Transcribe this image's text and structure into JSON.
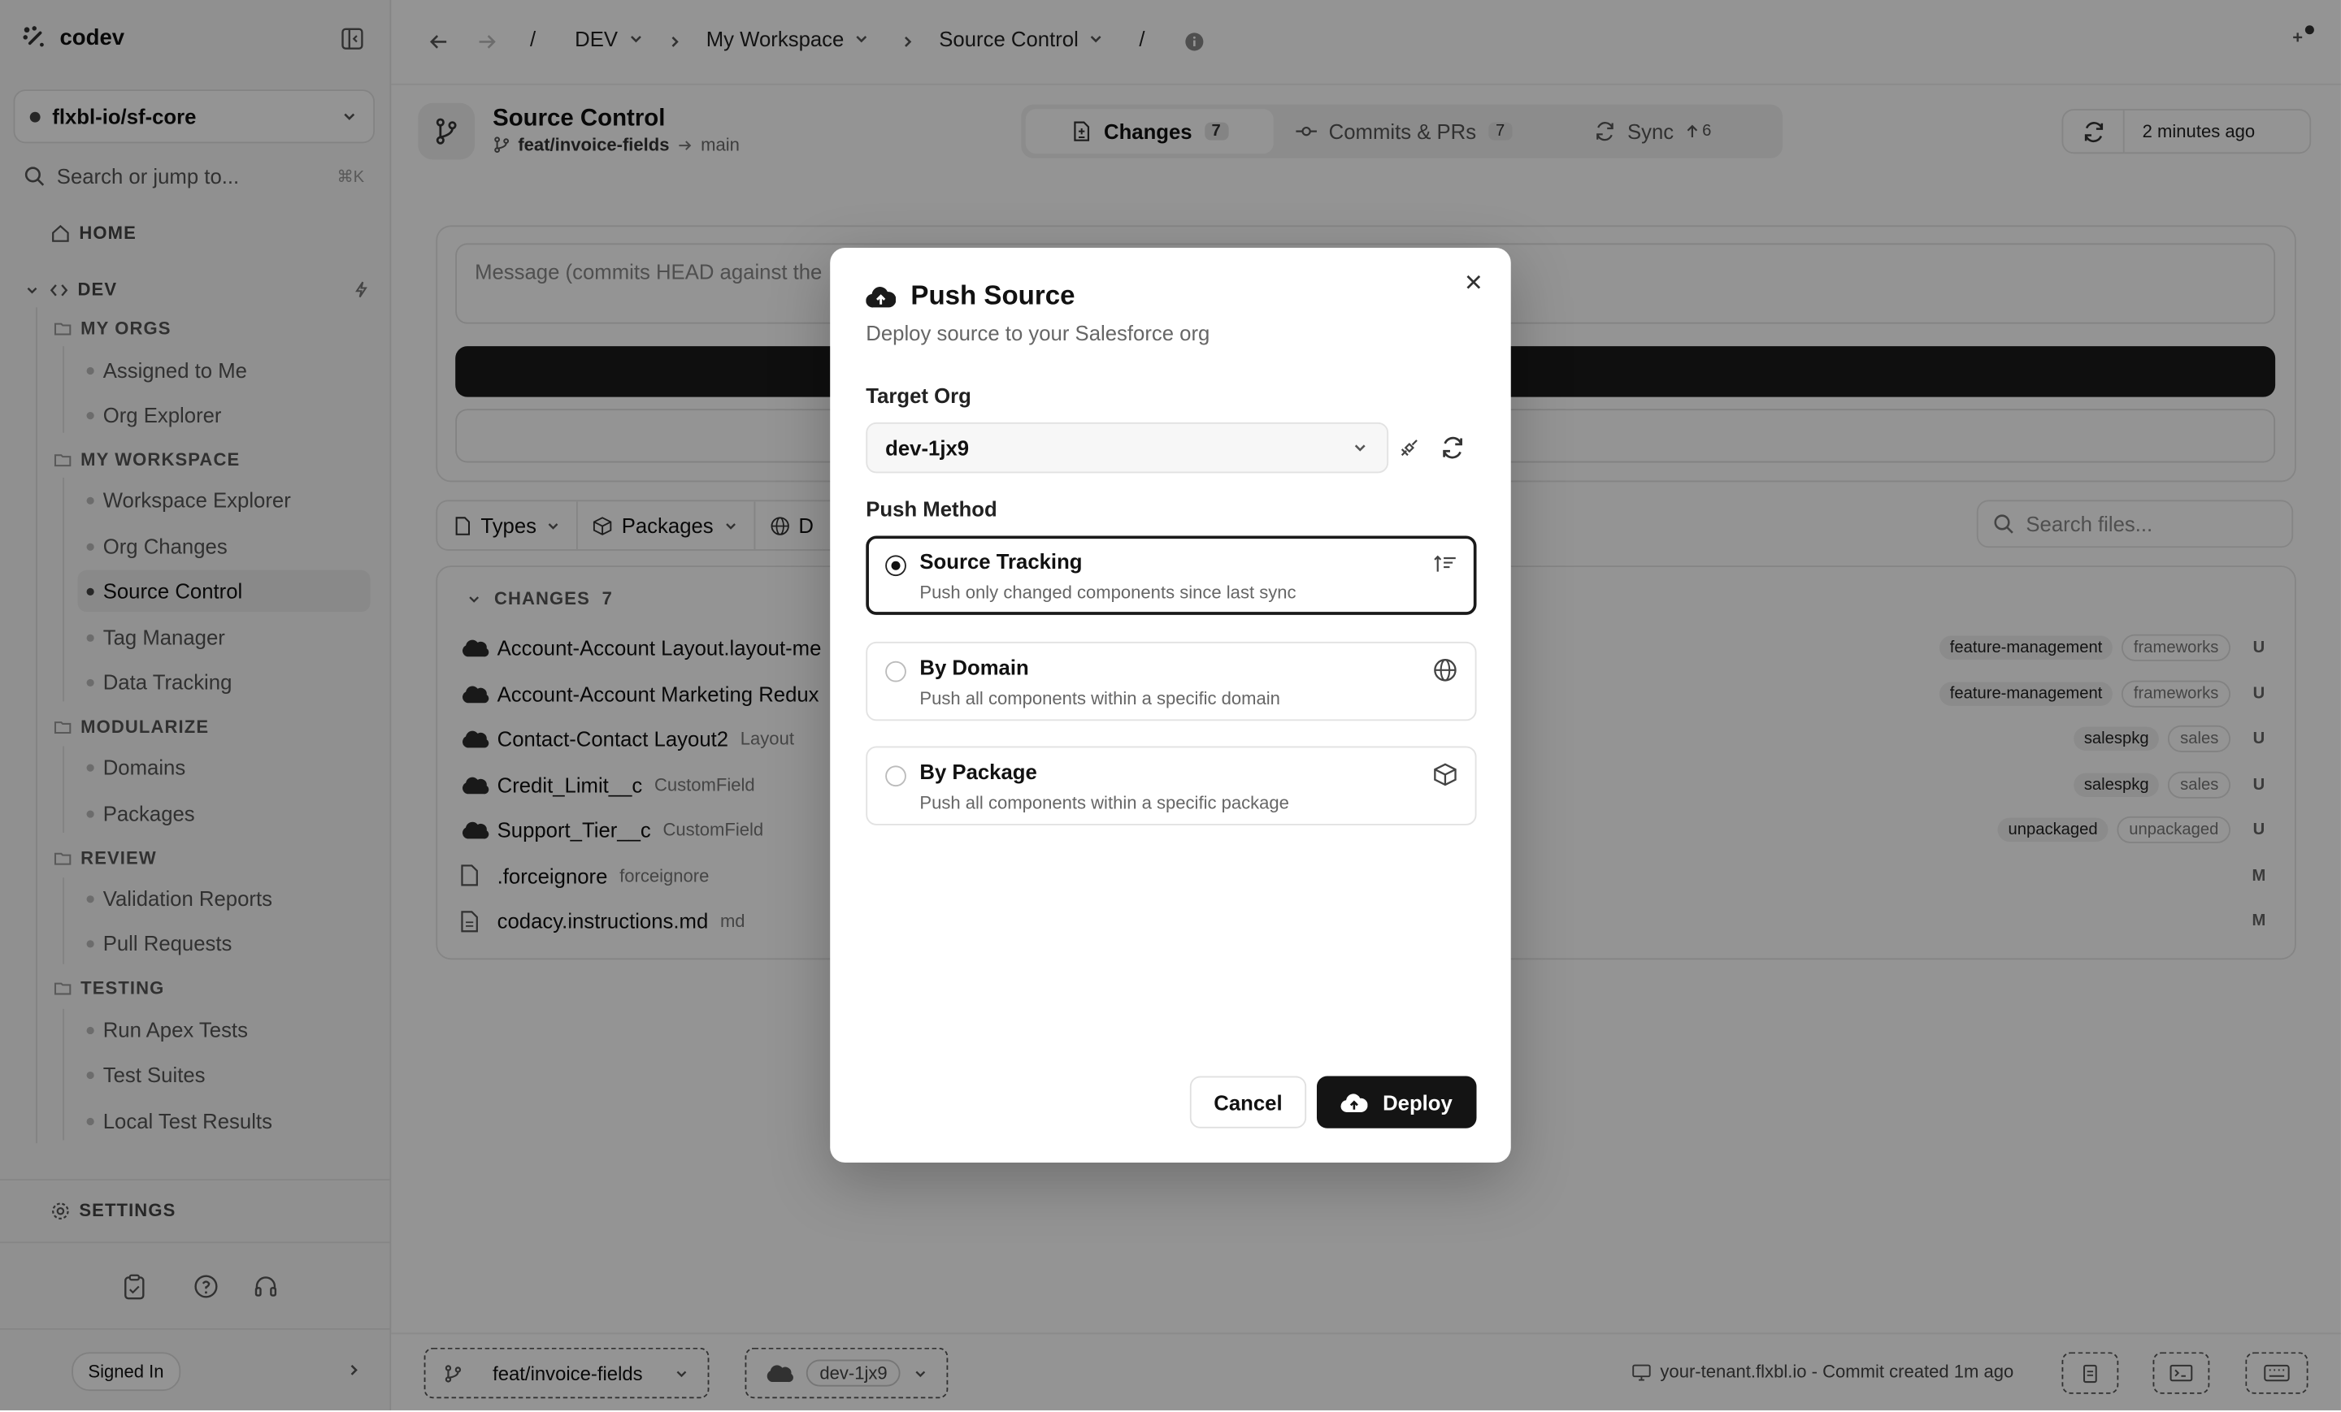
{
  "colors": {
    "accent": "#141414",
    "overlay": "rgba(0,0,0,0.42)",
    "salesforce": "#2b2b2b"
  },
  "sidebar": {
    "brand": "codev",
    "workspace": "flxbl-io/sf-core",
    "search_placeholder": "Search or jump to...",
    "search_shortcut": "⌘K",
    "home": "HOME",
    "env": "DEV",
    "groups": {
      "my_orgs": {
        "label": "MY ORGS",
        "items": [
          "Assigned to Me",
          "Org Explorer"
        ]
      },
      "my_workspace": {
        "label": "MY WORKSPACE",
        "items": [
          "Workspace Explorer",
          "Org Changes",
          "Source Control",
          "Tag Manager",
          "Data Tracking"
        ]
      },
      "modularize": {
        "label": "MODULARIZE",
        "items": [
          "Domains",
          "Packages"
        ]
      },
      "review": {
        "label": "REVIEW",
        "items": [
          "Validation Reports",
          "Pull Requests"
        ]
      },
      "testing": {
        "label": "TESTING",
        "items": [
          "Run Apex Tests",
          "Test Suites",
          "Local Test Results"
        ]
      }
    },
    "settings": "SETTINGS",
    "signed_in": "Signed In"
  },
  "topbar": {
    "crumbs": [
      "DEV",
      "My Workspace",
      "Source Control"
    ],
    "sep": "/"
  },
  "header": {
    "title": "Source Control",
    "branch": "feat/invoice-fields",
    "target": "main",
    "tabs": [
      {
        "label": "Changes",
        "count": "7"
      },
      {
        "label": "Commits & PRs",
        "count": "7"
      },
      {
        "label": "Sync",
        "count": "6"
      }
    ],
    "last_sync": "2 minutes ago"
  },
  "main": {
    "message_placeholder": "Message (commits HEAD against the",
    "filters": [
      "Types",
      "Packages",
      "D"
    ],
    "files_search_placeholder": "Search files...",
    "changes_label": "CHANGES",
    "changes_count": "7",
    "files": [
      {
        "name": "Account-Account Layout.layout-me",
        "type": "",
        "tags": [
          "feature-management",
          "frameworks"
        ],
        "status": "U",
        "icon": "salesforce-cloud-icon"
      },
      {
        "name": "Account-Account Marketing Redux",
        "type": "",
        "tags": [
          "feature-management",
          "frameworks"
        ],
        "status": "U",
        "icon": "salesforce-cloud-icon"
      },
      {
        "name": "Contact-Contact Layout2",
        "type": "Layout",
        "tags": [
          "salespkg",
          "sales"
        ],
        "status": "U",
        "icon": "salesforce-cloud-icon"
      },
      {
        "name": "Credit_Limit__c",
        "type": "CustomField",
        "tags": [
          "salespkg",
          "sales"
        ],
        "status": "U",
        "icon": "salesforce-cloud-icon"
      },
      {
        "name": "Support_Tier__c",
        "type": "CustomField",
        "tags": [
          "unpackaged",
          "unpackaged"
        ],
        "status": "U",
        "icon": "salesforce-cloud-icon"
      },
      {
        "name": ".forceignore",
        "type": "forceignore",
        "tags": [],
        "status": "M",
        "icon": "file-icon"
      },
      {
        "name": "codacy.instructions.md",
        "type": "md",
        "tags": [],
        "status": "M",
        "icon": "file-text-icon"
      }
    ]
  },
  "statusbar": {
    "branch": "feat/invoice-fields",
    "org": "dev-1jx9",
    "info": "your-tenant.flxbl.io - Commit created 1m ago"
  },
  "dialog": {
    "title": "Push Source",
    "subtitle": "Deploy source to your Salesforce org",
    "target_org_label": "Target Org",
    "target_org_value": "dev-1jx9",
    "push_method_label": "Push Method",
    "options": [
      {
        "title": "Source Tracking",
        "desc": "Push only changed components since last sync",
        "selected": true
      },
      {
        "title": "By Domain",
        "desc": "Push all components within a specific domain",
        "selected": false
      },
      {
        "title": "By Package",
        "desc": "Push all components within a specific package",
        "selected": false
      }
    ],
    "cancel": "Cancel",
    "deploy": "Deploy"
  }
}
